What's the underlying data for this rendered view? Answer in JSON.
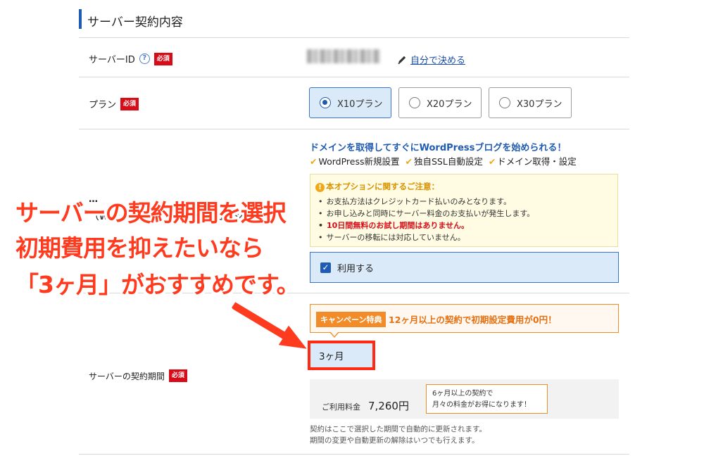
{
  "section": {
    "title": "サーバー契約内容"
  },
  "server_id": {
    "label": "サーバーID",
    "help": "?",
    "required": "必須",
    "custom_link": "自分で決める"
  },
  "plan": {
    "label": "プラン",
    "required": "必須",
    "options": [
      {
        "label": "X10プラン",
        "selected": true
      },
      {
        "label": "X20プラン",
        "selected": false
      },
      {
        "label": "X30プラン",
        "selected": false
      }
    ]
  },
  "wordpress": {
    "headline": "ドメインを取得してすぐにWordPressブログを始められる！",
    "features": [
      "WordPress新規設置",
      "独自SSL自動設定",
      "ドメイン取得・設定"
    ],
    "partial_label": "…",
    "partial_sublabel": "（WordPressの一括設定無料オプション）",
    "notice_title": "本オプションに関するご注意：",
    "notices": [
      "お支払方法はクレジットカード払いのみとなります。",
      "お申し込みと同時にサーバー料金のお支払いが発生します。",
      "10日間無料のお試し期間はありません。",
      "サーバーの移転には対応していません。"
    ],
    "use_label": "利用する"
  },
  "annotation": {
    "line1": "サーバーの契約期間を選択",
    "line2": "初期費用を抑えたいなら",
    "line3": "「3ヶ月」がおすすめです。"
  },
  "campaign": {
    "tag": "キャンペーン特典",
    "text": "12ヶ月以上の契約で初期設定費用が0円！"
  },
  "period": {
    "label": "サーバーの契約期間",
    "required": "必須",
    "value": "3ヶ月"
  },
  "price": {
    "label": "ご利用料金",
    "value": "7,260円",
    "note_line1": "6ヶ月以上の契約で",
    "note_line2": "月々の料金がお得になります！"
  },
  "footnote": {
    "line1": "契約はここで選択した期間で自動的に更新されます。",
    "line2": "期間の変更や自動更新の解除はいつでも行えます。"
  },
  "colors": {
    "accent": "#1f5bb3",
    "required": "#d70c18",
    "annotation": "#ff3b1f",
    "campaign": "#f28c28"
  }
}
